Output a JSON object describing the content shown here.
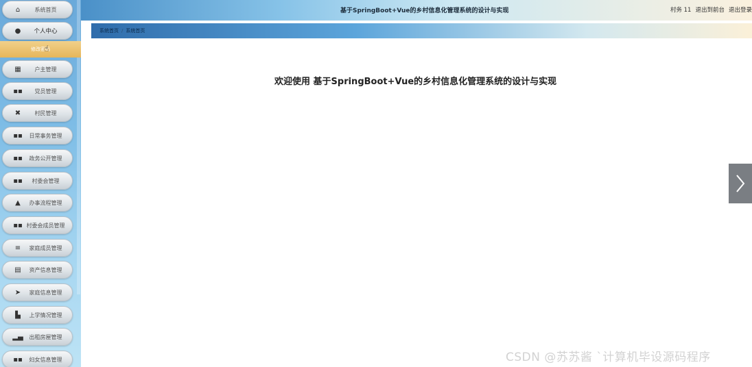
{
  "header": {
    "title": "基于SpringBoot+Vue的乡村信息化管理系统的设计与实现",
    "user_label": "村务 11",
    "exit_front": "退出到前台",
    "logout": "退出登录"
  },
  "breadcrumb": {
    "home": "系统首页",
    "separator": "/",
    "current": "系统首页"
  },
  "main": {
    "welcome": "欢迎使用 基于SpringBoot+Vue的乡村信息化管理系统的设计与实现"
  },
  "sidebar": {
    "items": [
      {
        "label": "系统首页",
        "icon": "home-icon",
        "glyph": "⌂"
      },
      {
        "label": "个人中心",
        "icon": "user-icon",
        "glyph": "●"
      },
      {
        "label": "户主管理",
        "icon": "building-icon",
        "glyph": "▦"
      },
      {
        "label": "党员管理",
        "icon": "grid-icon",
        "glyph": "▪▪"
      },
      {
        "label": "村民管理",
        "icon": "grid-icon",
        "glyph": "✖"
      },
      {
        "label": "日常事务管理",
        "icon": "grid-icon",
        "glyph": "▪▪"
      },
      {
        "label": "政务公开管理",
        "icon": "grid-icon",
        "glyph": "▪▪"
      },
      {
        "label": "村委会管理",
        "icon": "grid-icon",
        "glyph": "▪▪"
      },
      {
        "label": "办事流程管理",
        "icon": "bank-icon",
        "glyph": "▲"
      },
      {
        "label": "村委会成员管理",
        "icon": "grid-icon",
        "glyph": "▪▪"
      },
      {
        "label": "家庭成员管理",
        "icon": "list-icon",
        "glyph": "≡"
      },
      {
        "label": "资产信息管理",
        "icon": "file-icon",
        "glyph": "▤"
      },
      {
        "label": "家庭信息管理",
        "icon": "send-icon",
        "glyph": "➤"
      },
      {
        "label": "上学情况管理",
        "icon": "chart-icon",
        "glyph": "▙"
      },
      {
        "label": "出租房屋管理",
        "icon": "bar-chart-icon",
        "glyph": "▂▄"
      },
      {
        "label": "妇女信息管理",
        "icon": "grid-icon",
        "glyph": "▪▪"
      }
    ],
    "submenu_label": "修改密码"
  },
  "watermark": "CSDN @苏苏酱    ˋ计算机毕设源码程序"
}
